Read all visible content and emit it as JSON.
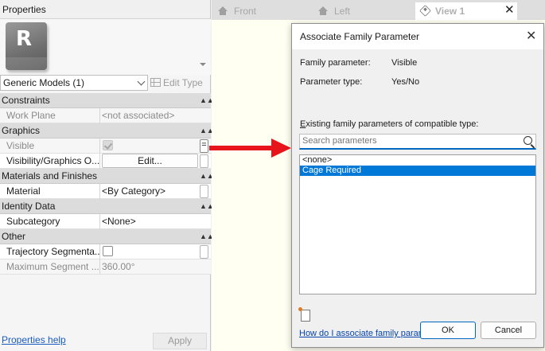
{
  "properties": {
    "title": "Properties",
    "type_selector": "Generic Models (1)",
    "edit_type_label": "Edit Type",
    "help_link": "Properties help",
    "apply_label": "Apply",
    "groups": {
      "constraints": {
        "label": "Constraints",
        "work_plane": {
          "name": "Work Plane",
          "value": "<not associated>"
        }
      },
      "graphics": {
        "label": "Graphics",
        "visible": {
          "name": "Visible"
        },
        "vis_overrides": {
          "name": "Visibility/Graphics O...",
          "button": "Edit..."
        }
      },
      "materials": {
        "label": "Materials and Finishes",
        "material": {
          "name": "Material",
          "value": "<By Category>"
        }
      },
      "identity": {
        "label": "Identity Data",
        "subcategory": {
          "name": "Subcategory",
          "value": "<None>"
        }
      },
      "other": {
        "label": "Other",
        "trajectory": {
          "name": "Trajectory Segmenta..."
        },
        "max_segment": {
          "name": "Maximum Segment ...",
          "value": "360.00°"
        }
      }
    },
    "associate_symbol": "="
  },
  "tabs": {
    "front": "Front",
    "left": "Left",
    "view1": "View 1",
    "close_glyph": "✕"
  },
  "dialog": {
    "title": "Associate Family Parameter",
    "close_glyph": "✕",
    "family_parameter_label": "Family parameter:",
    "family_parameter_value": "Visible",
    "parameter_type_label": "Parameter type:",
    "parameter_type_value": "Yes/No",
    "existing_label_accel": "E",
    "existing_label_rest": "xisting family parameters of compatible type:",
    "search_placeholder": "Search parameters",
    "list": [
      "<none>",
      "Cage Required"
    ],
    "help_link": "How do I associate family parameters?",
    "ok_label": "OK",
    "cancel_label": "Cancel"
  },
  "colors": {
    "selection": "#0078d7",
    "arrow": "#e8141b",
    "link": "#0645ad"
  }
}
